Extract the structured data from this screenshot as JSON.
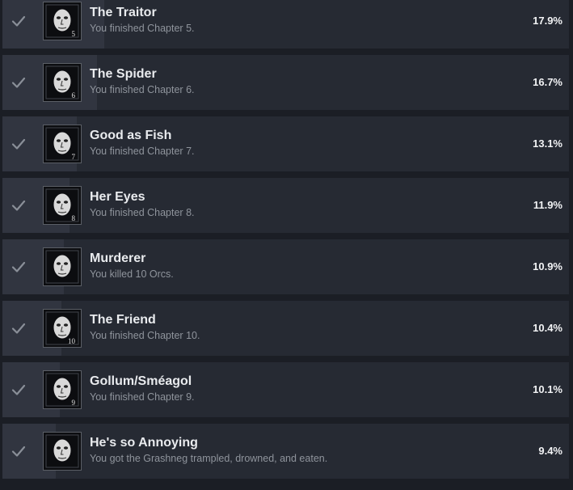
{
  "achievements": [
    {
      "title": "The Traitor",
      "description": "You finished Chapter 5.",
      "percent": "17.9%",
      "progress": 17.9,
      "icon": "traitor-portrait-icon",
      "chapter_mark": "5"
    },
    {
      "title": "The Spider",
      "description": "You finished Chapter 6.",
      "percent": "16.7%",
      "progress": 16.7,
      "icon": "spider-portrait-icon",
      "chapter_mark": "6"
    },
    {
      "title": "Good as Fish",
      "description": "You finished Chapter 7.",
      "percent": "13.1%",
      "progress": 13.1,
      "icon": "fish-creature-icon",
      "chapter_mark": "7"
    },
    {
      "title": "Her Eyes",
      "description": "You finished Chapter 8.",
      "percent": "11.9%",
      "progress": 11.9,
      "icon": "woman-portrait-icon",
      "chapter_mark": "8"
    },
    {
      "title": "Murderer",
      "description": "You killed 10 Orcs.",
      "percent": "10.9%",
      "progress": 10.9,
      "icon": "orc-portrait-icon",
      "chapter_mark": ""
    },
    {
      "title": "The Friend",
      "description": "You finished Chapter 10.",
      "percent": "10.4%",
      "progress": 10.4,
      "icon": "winged-creature-icon",
      "chapter_mark": "10"
    },
    {
      "title": "Gollum/Sméagol",
      "description": "You finished Chapter 9.",
      "percent": "10.1%",
      "progress": 10.1,
      "icon": "gollum-face-icon",
      "chapter_mark": "9"
    },
    {
      "title": "He's so Annoying",
      "description": "You got the Grashneg trampled, drowned, and eaten.",
      "percent": "9.4%",
      "progress": 9.4,
      "icon": "bearded-face-icon",
      "chapter_mark": ""
    }
  ],
  "colors": {
    "background": "#1b1e25",
    "row": "#262a33",
    "progress_fill": "#313540",
    "title": "#e9ebee",
    "description": "#8f949c",
    "check": "#8a8f98"
  }
}
